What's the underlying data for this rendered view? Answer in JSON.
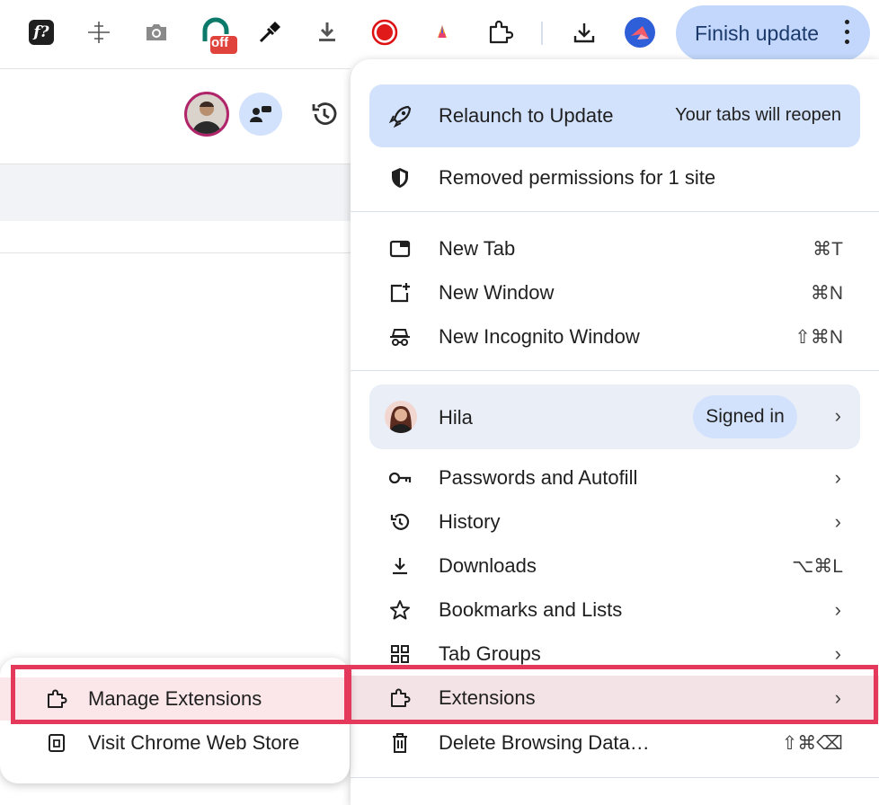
{
  "toolbar": {
    "icons": [
      {
        "name": "font-identifier-icon",
        "glyph": "f?"
      },
      {
        "name": "crosshair-move-icon"
      },
      {
        "name": "camera-icon"
      },
      {
        "name": "disconnect-extension-icon",
        "badge": "off"
      },
      {
        "name": "eyedropper-icon"
      },
      {
        "name": "download-arrow-icon"
      },
      {
        "name": "record-icon"
      },
      {
        "name": "colorful-drop-icon"
      },
      {
        "name": "puzzle-extensions-icon"
      },
      {
        "name": "downloads-icon"
      },
      {
        "name": "profile-avatar-icon"
      }
    ],
    "finish_update": "Finish update"
  },
  "menu": {
    "relaunch": {
      "label": "Relaunch to Update",
      "note": "Your tabs will reopen"
    },
    "removed_permissions": "Removed permissions for 1 site",
    "new_tab": {
      "label": "New Tab",
      "shortcut": "⌘T"
    },
    "new_window": {
      "label": "New Window",
      "shortcut": "⌘N"
    },
    "new_incognito": {
      "label": "New Incognito Window",
      "shortcut": "⇧⌘N"
    },
    "profile": {
      "name": "Hila",
      "status": "Signed in"
    },
    "passwords": "Passwords and Autofill",
    "history": "History",
    "downloads": {
      "label": "Downloads",
      "shortcut": "⌥⌘L"
    },
    "bookmarks": "Bookmarks and Lists",
    "tab_groups": "Tab Groups",
    "extensions": "Extensions",
    "delete_data": {
      "label": "Delete Browsing Data…",
      "shortcut": "⇧⌘⌫"
    },
    "chevron": "›"
  },
  "submenu": {
    "manage_extensions": "Manage Extensions",
    "visit_store": "Visit Chrome Web Store"
  },
  "colors": {
    "accent_pill": "#c2d7fb",
    "highlight_box": "#e5395c",
    "extensions_row_bg": "#f3e3e6"
  }
}
